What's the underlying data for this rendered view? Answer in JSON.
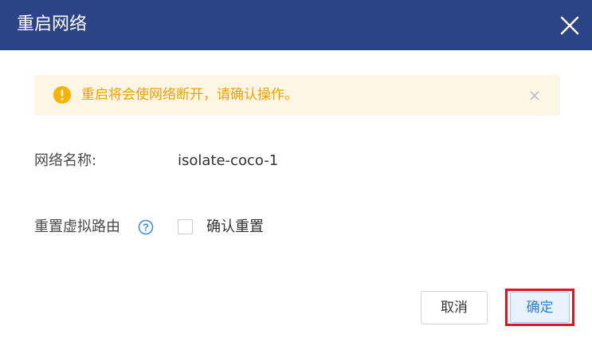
{
  "dialog": {
    "title": "重启网络",
    "close_icon": "close-icon"
  },
  "alert": {
    "icon": "warning-icon",
    "message": "重启将会使网络断开，请确认操作。",
    "close_icon": "close-icon",
    "color": "#f0a000",
    "background": "#fdf6e4"
  },
  "form": {
    "network_name_label": "网络名称:",
    "network_name_value": "isolate-coco-1",
    "reset_router_label": "重置虚拟路由",
    "help_icon": "help-icon",
    "confirm_reset_label": "确认重置",
    "confirm_reset_checked": false
  },
  "footer": {
    "cancel_label": "取消",
    "ok_label": "确定"
  },
  "colors": {
    "header": "#2b4387",
    "primary": "#2f7fd8",
    "highlight": "#e0141e"
  }
}
